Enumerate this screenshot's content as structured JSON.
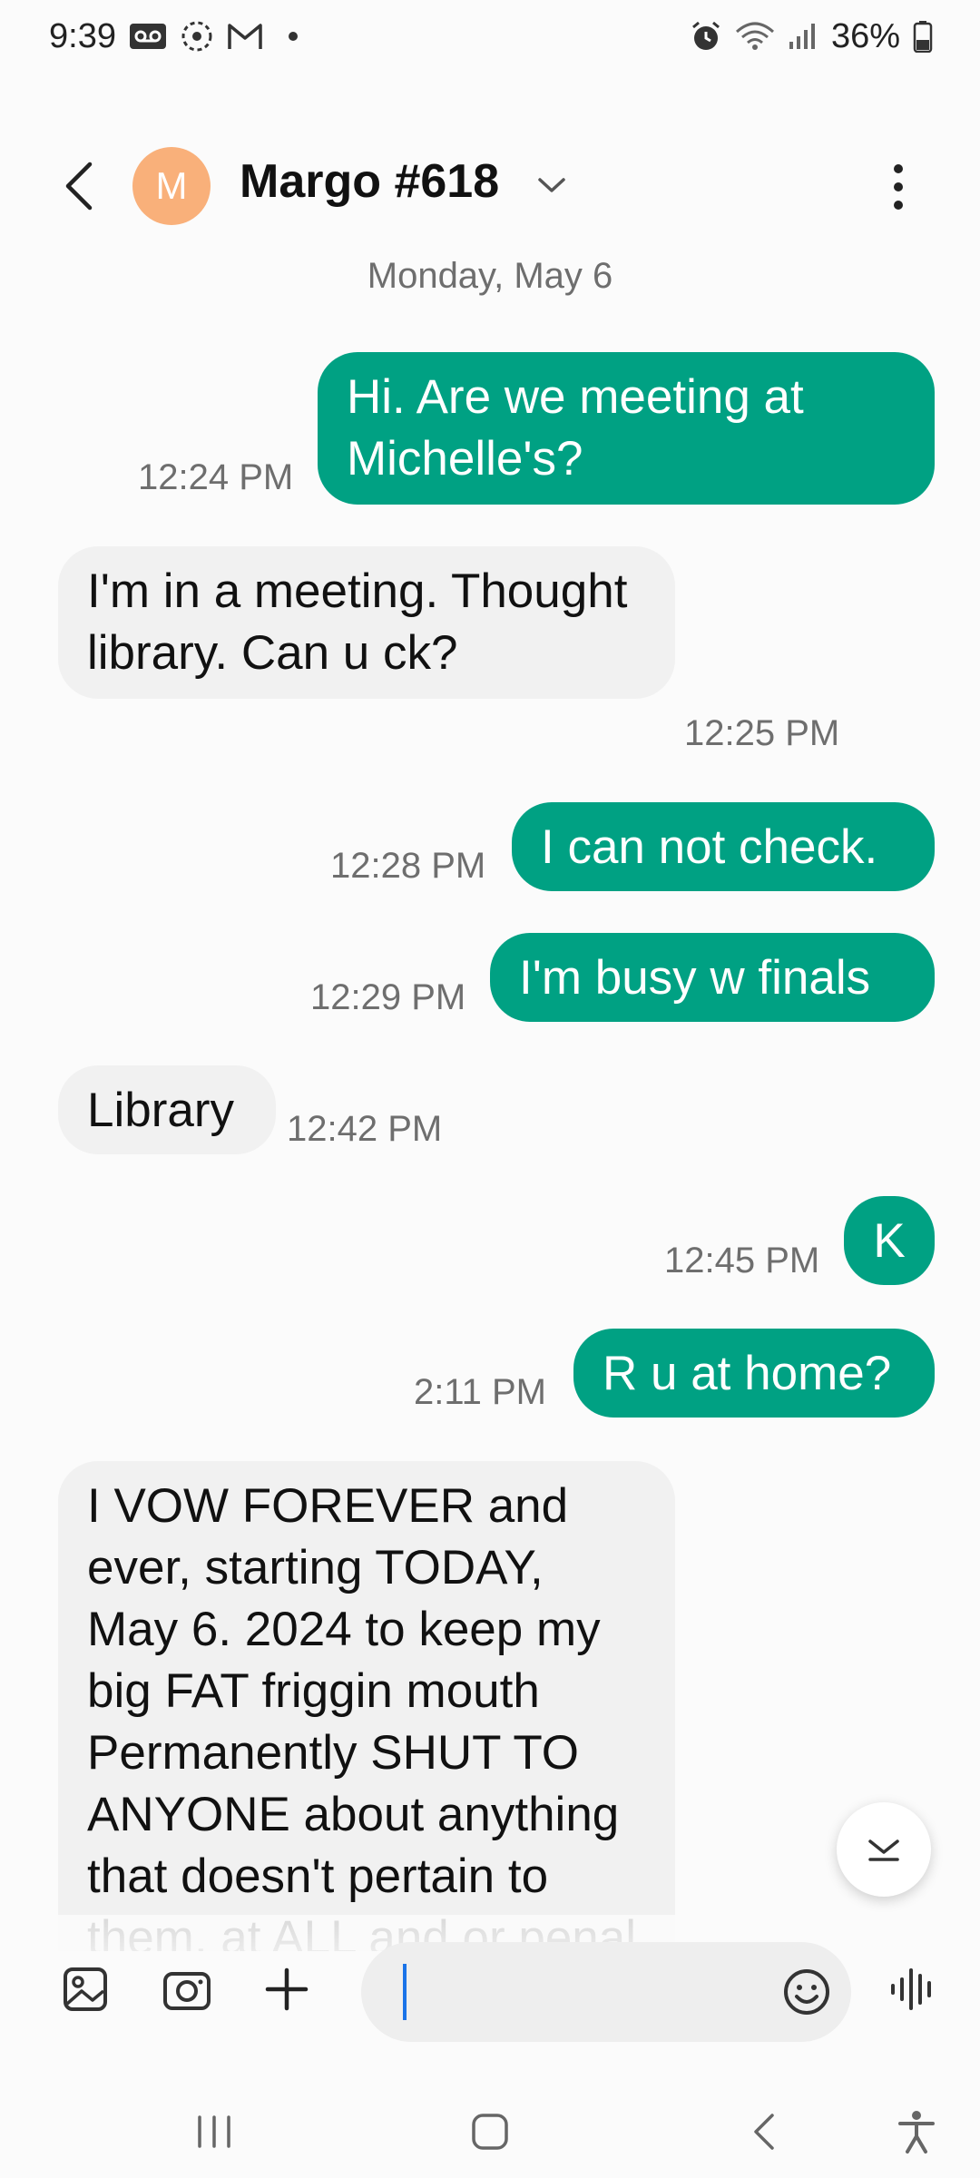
{
  "status_bar": {
    "time": "9:39",
    "battery": "36%"
  },
  "header": {
    "avatar_letter": "M",
    "contact_name": "Margo #618"
  },
  "date_separator": "Monday, May 6",
  "messages": [
    {
      "direction": "sent",
      "text": "Hi. Are we meeting at Michelle's?",
      "time": "12:24 PM"
    },
    {
      "direction": "received",
      "text": "I'm in a meeting. Thought library. Can u ck?",
      "time": "12:25 PM"
    },
    {
      "direction": "sent",
      "text": "I can not check.",
      "time": "12:28 PM"
    },
    {
      "direction": "sent",
      "text": "I'm busy w finals",
      "time": "12:29 PM"
    },
    {
      "direction": "received",
      "text": "Library",
      "time": "12:42 PM"
    },
    {
      "direction": "sent",
      "text": "K",
      "time": "12:45 PM"
    },
    {
      "direction": "sent",
      "text": "R u at home?",
      "time": "2:11 PM"
    },
    {
      "direction": "received",
      "text": "I VOW FOREVER and ever, starting TODAY, May 6. 2024 to keep my big FAT friggin mouth Permanently SHUT TO ANYONE about anything that doesn't pertain to them, at ALL and or penal a very special and"
    }
  ],
  "composer": {
    "input_value": ""
  },
  "colors": {
    "sent_bubble": "#00a183",
    "received_bubble": "#f1f1f1",
    "avatar": "#f9b07a"
  },
  "icons": {
    "status": [
      "voicemail-icon",
      "settings-dots-icon",
      "gmail-icon",
      "alarm-icon",
      "wifi-icon",
      "signal-icon",
      "battery-icon"
    ],
    "header": [
      "back-arrow-icon",
      "chevron-down-icon",
      "more-vert-icon"
    ],
    "composer": [
      "gallery-icon",
      "camera-icon",
      "plus-icon",
      "emoji-icon",
      "voice-icon"
    ],
    "nav": [
      "recents-icon",
      "home-icon",
      "back-icon",
      "accessibility-icon"
    ]
  }
}
